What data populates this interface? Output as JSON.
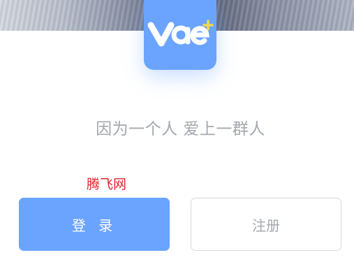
{
  "logo": {
    "icon": "vae-plus-logo",
    "text": "Vae",
    "accent": "#6aa4ff",
    "plus_color": "#f5d84a"
  },
  "tagline": "因为一个人 爱上一群人",
  "watermark": "腾飞网",
  "buttons": {
    "login_label": "登 录",
    "register_label": "注册"
  }
}
